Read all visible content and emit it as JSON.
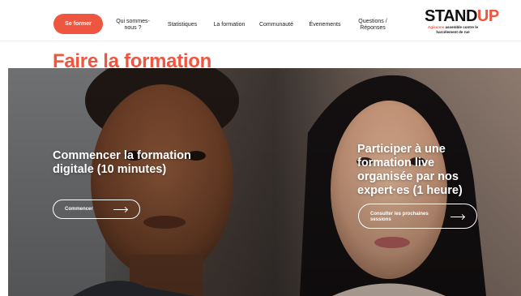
{
  "header": {
    "cta_label": "Se former",
    "nav": [
      {
        "label": "Qui sommes-\nnous ?"
      },
      {
        "label": "Statistiques"
      },
      {
        "label": "La formation"
      },
      {
        "label": "Communauté"
      },
      {
        "label": "Évenements"
      },
      {
        "label": "Questions /\nRéponses"
      }
    ],
    "brand": {
      "word_stand": "STAND",
      "word_up": "UP",
      "tagline_accent": "Agissons",
      "tagline_rest": " assemble contre le harcèlement de rue"
    }
  },
  "page": {
    "title": "Faire la formation"
  },
  "hero": {
    "left": {
      "heading": "Commencer la formation digitale (10 minutes)",
      "button_label": "Commencer"
    },
    "right": {
      "heading": "Participer à une formation live organisée par nos expert·es (1 heure)",
      "button_label": "Consulter les prochaines sessions"
    }
  },
  "colors": {
    "accent": "#ef5640",
    "text": "#111111",
    "on_image": "#ffffff"
  }
}
